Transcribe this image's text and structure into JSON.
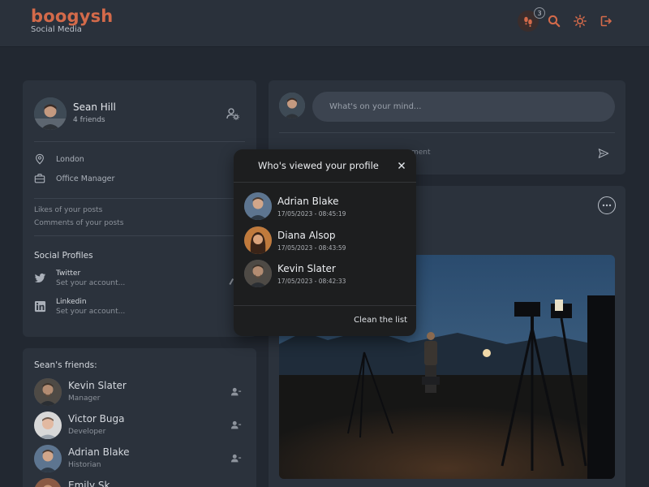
{
  "app": {
    "brand": "boogysh",
    "subtitle": "Social Media"
  },
  "header": {
    "icons": [
      "footprints-icon",
      "search-icon",
      "sun-icon",
      "logout-icon"
    ],
    "notification_count": "3",
    "accent": "#d36a4a"
  },
  "profile": {
    "name": "Sean Hill",
    "friends": "4 friends",
    "location": "London",
    "job": "Office Manager",
    "likes_label": "Likes of your posts",
    "comments_label": "Comments of your posts",
    "social_title": "Social Profiles",
    "social": [
      {
        "name": "Twitter",
        "placeholder": "Set your account..."
      },
      {
        "name": "Linkedin",
        "placeholder": "Set your account..."
      }
    ]
  },
  "friends_section": {
    "title": "Sean's friends:",
    "items": [
      {
        "name": "Kevin Slater",
        "job": "Manager"
      },
      {
        "name": "Victor Buga",
        "job": "Developer"
      },
      {
        "name": "Adrian Blake",
        "job": "Historian"
      },
      {
        "name": "Emily Sk",
        "job": ""
      }
    ]
  },
  "post": {
    "placeholder": "What's on your mind...",
    "comment_peek": "ment"
  },
  "modal": {
    "title": "Who's viewed your profile",
    "viewers": [
      {
        "name": "Adrian Blake",
        "time": "17/05/2023 - 08:45:19"
      },
      {
        "name": "Diana Alsop",
        "time": "17/05/2023 - 08:43:59"
      },
      {
        "name": "Kevin Slater",
        "time": "17/05/2023 - 08:42:33"
      }
    ],
    "clean_label": "Clean the list"
  }
}
